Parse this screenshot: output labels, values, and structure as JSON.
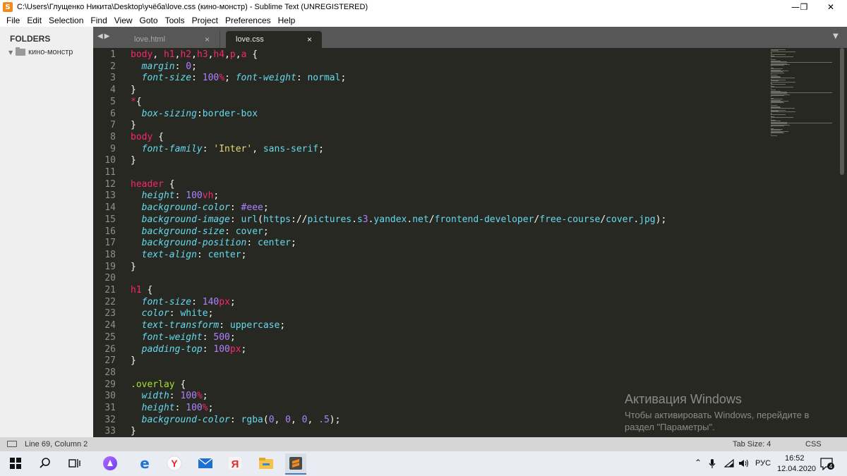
{
  "window": {
    "title": "C:\\Users\\Глущенко Никита\\Desktop\\учёба\\love.css (кино-монстр) - Sublime Text (UNREGISTERED)",
    "minimize": "—",
    "maximize": "❐",
    "close": "✕"
  },
  "menu": [
    "File",
    "Edit",
    "Selection",
    "Find",
    "View",
    "Goto",
    "Tools",
    "Project",
    "Preferences",
    "Help"
  ],
  "sidebar": {
    "title": "FOLDERS",
    "folder": "кино-монстр"
  },
  "tabs": [
    {
      "label": "love.html",
      "active": false
    },
    {
      "label": "love.css",
      "active": true
    }
  ],
  "editor": {
    "line_numbers": [
      "1",
      "2",
      "3",
      "4",
      "5",
      "6",
      "7",
      "8",
      "9",
      "10",
      "11",
      "12",
      "13",
      "14",
      "15",
      "16",
      "17",
      "18",
      "19",
      "20",
      "21",
      "22",
      "23",
      "24",
      "25",
      "26",
      "27",
      "28",
      "29",
      "30",
      "31",
      "32",
      "33"
    ],
    "code": [
      "body, h1,h2,h3,h4,p,a {",
      "  margin: 0;",
      "  font-size: 100%; font-weight: normal;",
      "}",
      "*{",
      "  box-sizing:border-box",
      "}",
      "body {",
      "  font-family: 'Inter', sans-serif;",
      "}",
      "",
      "header {",
      "  height: 100vh;",
      "  background-color: #eee;",
      "  background-image: url(https://pictures.s3.yandex.net/frontend-developer/free-course/cover.jpg);",
      "  background-size: cover;",
      "  background-position: center;",
      "  text-align: center;",
      "}",
      "",
      "h1 {",
      "  font-size: 140px;",
      "  color: white;",
      "  text-transform: uppercase;",
      "  font-weight: 500;",
      "  padding-top: 100px;",
      "}",
      "",
      ".overlay {",
      "  width: 100%;",
      "  height: 100%;",
      "  background-color: rgba(0, 0, 0, .5);",
      "}"
    ]
  },
  "watermark": {
    "title": "Активация Windows",
    "line1": "Чтобы активировать Windows, перейдите в",
    "line2": "раздел \"Параметры\"."
  },
  "status": {
    "position": "Line 69, Column 2",
    "tab_size": "Tab Size: 4",
    "syntax": "CSS"
  },
  "taskbar": {
    "lang": "РУС",
    "time": "16:52",
    "date": "12.04.2020",
    "notifications": "4"
  },
  "colors": {
    "editor_bg": "#272822",
    "keyword": "#f92672",
    "property": "#66d9ef",
    "number": "#ae81ff",
    "string": "#e6db74",
    "class": "#a6e22e"
  }
}
